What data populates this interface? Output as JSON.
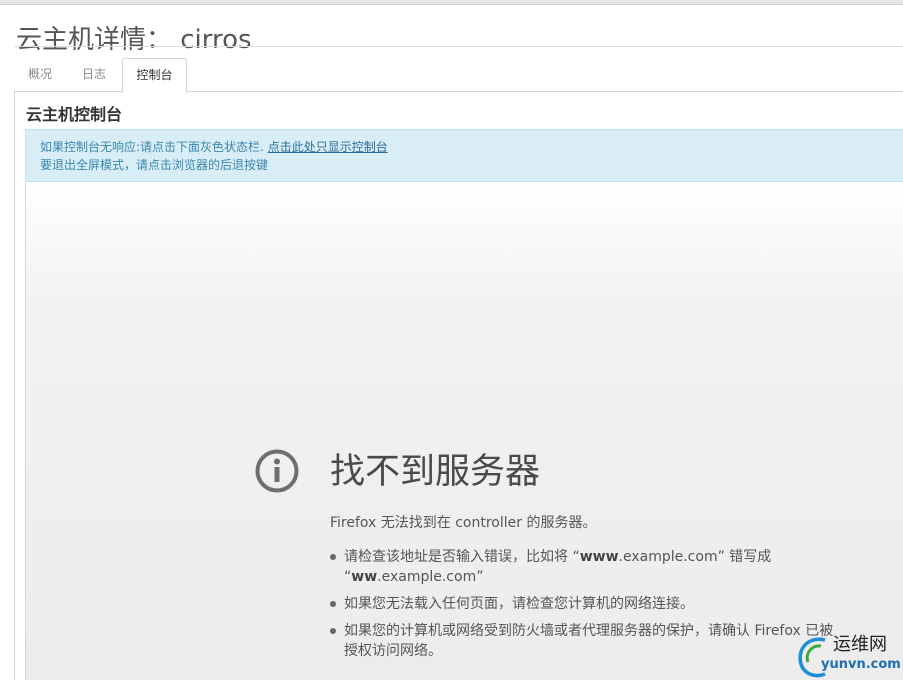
{
  "page": {
    "title": "云主机详情： cirros"
  },
  "tabs": [
    {
      "label": "概况",
      "active": false
    },
    {
      "label": "日志",
      "active": false
    },
    {
      "label": "控制台",
      "active": true
    }
  ],
  "console": {
    "heading": "云主机控制台",
    "info_line1_text": "如果控制台无响应:请点击下面灰色状态栏.",
    "info_line1_link": "点击此处只显示控制台",
    "info_line2": "要退出全屏模式，请点击浏览器的后退按键"
  },
  "error_page": {
    "icon": "info-circle-icon",
    "title": "找不到服务器",
    "description": "Firefox 无法找到在 controller 的服务器。",
    "items": [
      {
        "pre": "请检查该地址是否输入错误，比如将 “",
        "bold1": "www",
        "mid1": ".example.com” 错写成",
        "line2_pre": "“",
        "bold2": "ww",
        "line2_post": ".example.com”"
      },
      {
        "text": "如果您无法载入任何页面，请检查您计算机的网络连接。"
      },
      {
        "text": "如果您的计算机或网络受到防火墙或者代理服务器的保护，请确认 Firefox 已被授权访问网络。"
      }
    ]
  },
  "watermark": {
    "name": "运维网",
    "domain": "yunvn.com"
  }
}
